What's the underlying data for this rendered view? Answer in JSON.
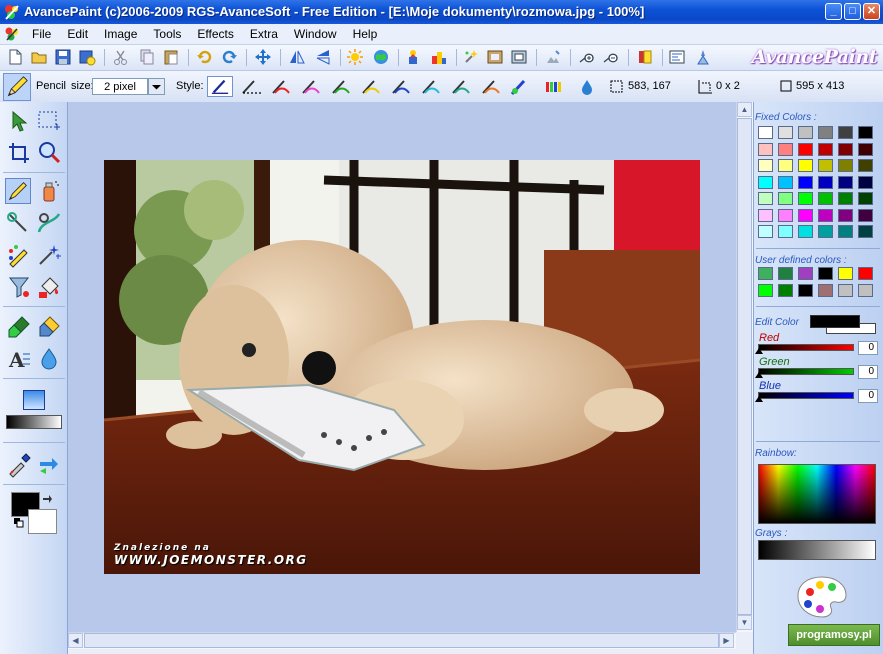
{
  "window": {
    "title": "AvancePaint (c)2006-2009 RGS-AvanceSoft - Free Edition - [E:\\Moje dokumenty\\rozmowa.jpg - 100%]",
    "minimize_glyph": "_",
    "maximize_glyph": "□",
    "close_glyph": "✕"
  },
  "menu": {
    "items": [
      "File",
      "Edit",
      "Image",
      "Tools",
      "Effects",
      "Extra",
      "Window",
      "Help"
    ]
  },
  "toolbar": {
    "logo_text": "AvancePaint"
  },
  "options": {
    "tool_name": "Pencil",
    "size_label": "size:",
    "size_value": "2 pixel",
    "style_label": "Style:",
    "cursor_position": "583, 167",
    "selection_size": "0 x 2",
    "image_size": "595 x 413"
  },
  "canvas": {
    "watermark_line1": "Znalezione na",
    "watermark_line2": "WWW.JOEMONSTER.ORG"
  },
  "panel": {
    "fixed_colors_label": "Fixed Colors :",
    "fixed_colors": [
      "#ffffff",
      "#e0e0e0",
      "#c0c0c0",
      "#808080",
      "#404040",
      "#000000",
      "#ffc0c0",
      "#ff8080",
      "#ff0000",
      "#c00000",
      "#800000",
      "#400000",
      "#ffffc0",
      "#ffff80",
      "#ffff00",
      "#c0c000",
      "#808000",
      "#404000",
      "#00ffff",
      "#00c0ff",
      "#0000ff",
      "#0000c0",
      "#000080",
      "#000040",
      "#c0ffc0",
      "#80ff80",
      "#00ff00",
      "#00c000",
      "#008000",
      "#004000",
      "#ffc0ff",
      "#ff80ff",
      "#ff00ff",
      "#c000c0",
      "#800080",
      "#400040",
      "#c0ffff",
      "#80ffff",
      "#00e0e0",
      "#00a0a0",
      "#008080",
      "#004040"
    ],
    "user_colors_label": "User defined colors :",
    "user_colors": [
      "#40b060",
      "#208040",
      "#a040c0",
      "#000000",
      "#ffff00",
      "#ff0000",
      "#00ff00",
      "#008000",
      "#000000",
      "#a07070",
      "#c0c0c0",
      "#c0c0c0"
    ],
    "edit_color_label": "Edit Color",
    "red_label": "Red",
    "green_label": "Green",
    "blue_label": "Blue",
    "red_value": "0",
    "green_value": "0",
    "blue_value": "0",
    "rainbow_label": "Rainbow:",
    "grays_label": "Grays :",
    "promo_text": "programosy.pl"
  }
}
